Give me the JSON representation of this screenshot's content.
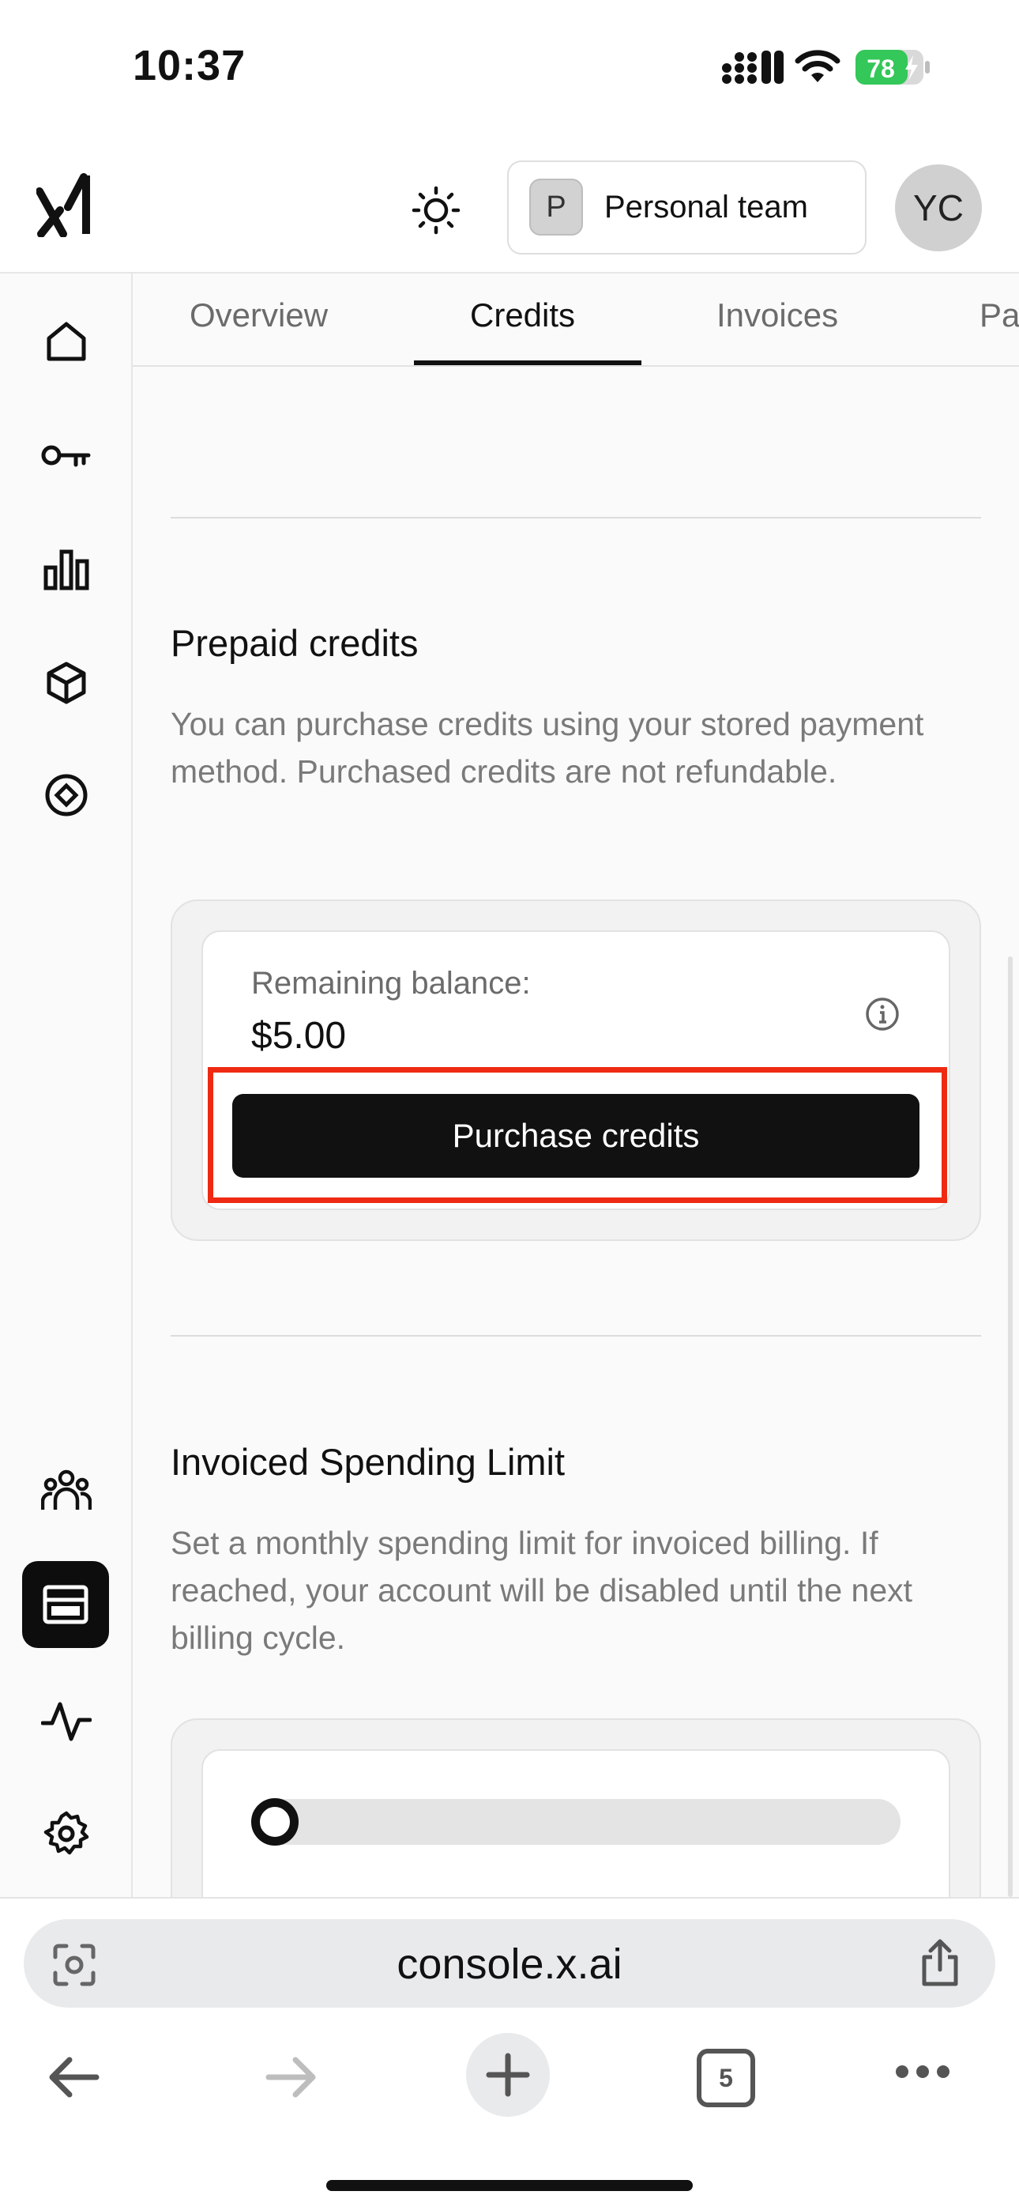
{
  "status_bar": {
    "time": "10:37",
    "battery": "78"
  },
  "header": {
    "logo": "xAI",
    "team_initial": "P",
    "team_label": "Personal team",
    "avatar_initials": "YC"
  },
  "tabs": [
    {
      "label": "Overview"
    },
    {
      "label": "Credits",
      "active": true
    },
    {
      "label": "Invoices"
    },
    {
      "label": "Pa"
    }
  ],
  "sidebar": {
    "items": [
      {
        "icon": "home-icon"
      },
      {
        "icon": "key-icon"
      },
      {
        "icon": "bar-chart-icon"
      },
      {
        "icon": "cube-icon"
      },
      {
        "icon": "target-icon"
      },
      {
        "icon": "team-icon"
      },
      {
        "icon": "billing-icon",
        "active": true
      },
      {
        "icon": "activity-icon"
      },
      {
        "icon": "settings-icon"
      }
    ]
  },
  "prepaid": {
    "title": "Prepaid credits",
    "description": "You can purchase credits using your stored payment method. Purchased credits are not refundable.",
    "balance_label": "Remaining balance:",
    "balance_value": "$5.00",
    "button_label": "Purchase credits"
  },
  "invoiced": {
    "title": "Invoiced Spending Limit",
    "description": "Set a monthly spending limit for invoiced billing. If reached, your account will be disabled until the next billing cycle.",
    "slider_value": 0
  },
  "browser": {
    "url": "console.x.ai",
    "tab_count": "5"
  },
  "colors": {
    "accent": "#111111",
    "highlight": "#ee2a12",
    "battery": "#34c759"
  }
}
